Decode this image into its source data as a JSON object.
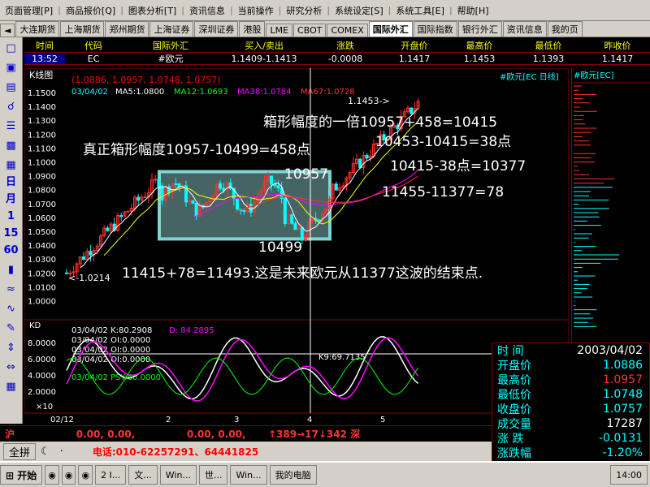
{
  "menu": [
    "页面管理[P]",
    "商品报价[Q]",
    "图表分析[T]",
    "资讯信息",
    "当前操作",
    "研究分析",
    "系统设定[S]",
    "系统工具[E]",
    "帮助[H]"
  ],
  "tabs": [
    "大连期货",
    "上海期货",
    "郑州期货",
    "上海证券",
    "深圳证券",
    "港股",
    "LME",
    "CBOT",
    "COMEX",
    "国际外汇",
    "国际指数",
    "银行外汇",
    "资讯信息",
    "我的页"
  ],
  "active_tab": "国际外汇",
  "quote": {
    "headers": [
      "时间",
      "代码",
      "国际外汇",
      "买入/卖出",
      "涨跌",
      "开盘价",
      "最高价",
      "最低价",
      "昨收价"
    ],
    "values": [
      "13:52",
      "EC",
      "#欧元",
      "1.1409-1.1413",
      "-0.0008",
      "1.1417",
      "1.1453",
      "1.1393",
      "1.1417"
    ]
  },
  "toolbar_vertical": [
    "日",
    "月",
    "1",
    "15",
    "60"
  ],
  "chart": {
    "title": "K线图",
    "ohlc_label": "(1.0886, 1.0957, 1.0748, 1.0757)",
    "ma_labels": [
      "03/04/02",
      "MA5:1.0800",
      "MA12:1.0693",
      "MA38:1.0784",
      "MA67:1.0728"
    ],
    "right_title": "#欧元[EC 日线]",
    "right_panel_title": "#欧元[EC]",
    "y_labels": [
      "1.1500",
      "1.1400",
      "1.1300",
      "1.1200",
      "1.1100",
      "1.1000",
      "1.0900",
      "1.0800",
      "1.0700",
      "1.0600",
      "1.0500",
      "1.0400",
      "1.0300",
      "1.0200",
      "1.0100",
      "1.0000"
    ],
    "high_label": "1.1453->",
    "low_label": "<-1.0214",
    "annotations": [
      "箱形幅度的一倍10957+458=10415",
      "真正箱形幅度10957-10499=458点",
      "10957",
      "10453-10415=38点",
      "10415-38点=10377",
      "11455-11377=78",
      "10499",
      "11415+78=11493.这是未来欧元从11377这波的结束点."
    ],
    "kd_title": "KD",
    "kd_labels": [
      "03/04/02 K:80.2908",
      "D: 84.2895",
      "03/04/02 OI:0.0000",
      "03/04/02 OI:0.0000",
      "03/04/02 OI:0.0000",
      "03/04/02 PSY:60.0000"
    ],
    "kd_y_labels": [
      "8.0000",
      "6.0000",
      "4.0000",
      "2.0000"
    ],
    "kd_mult": "×10",
    "crosshair_value": "K9:69.7135",
    "x_labels": [
      "02/12",
      "2",
      "3",
      "4",
      "5"
    ]
  },
  "info": [
    {
      "k": "时 间",
      "v": "2003/04/02",
      "color": "#fff"
    },
    {
      "k": "开盘价",
      "v": "1.0886",
      "color": "#0ff"
    },
    {
      "k": "最高价",
      "v": "1.0957",
      "color": "#f33"
    },
    {
      "k": "最低价",
      "v": "1.0748",
      "color": "#0ff"
    },
    {
      "k": "收盘价",
      "v": "1.0757",
      "color": "#0ff"
    },
    {
      "k": "成交量",
      "v": "17287",
      "color": "#fff"
    },
    {
      "k": "涨 跌",
      "v": "-0.0131",
      "color": "#0ff"
    },
    {
      "k": "涨跌幅",
      "v": "-1.20%",
      "color": "#0ff"
    }
  ],
  "status": {
    "prefix": "沪",
    "values": "0.00, 0.00,",
    "middle": "0.00, 0.00,",
    "arrows": "↑389→17↓342 深"
  },
  "bottom": {
    "btn1": "全拼",
    "phone": "电话:010-62257291、64441825"
  },
  "taskbar": {
    "start": "开始",
    "items": [
      "2 I...",
      "文...",
      "Win...",
      "世...",
      "Win...",
      "我的电脑"
    ],
    "clock": "14:00"
  },
  "colors": {
    "up": "#ff3030",
    "down": "#00ffff",
    "ma5": "#ffffff",
    "ma12": "#ffff00",
    "ma38": "#ff00ff",
    "ma67": "#00ff00",
    "box": "#7fd4d4"
  }
}
